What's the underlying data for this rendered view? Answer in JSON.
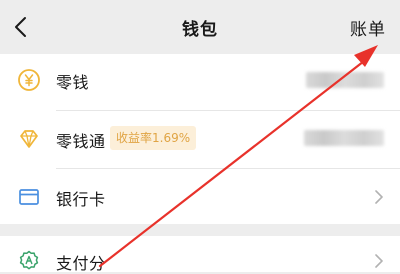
{
  "nav": {
    "back_icon": "chevron-left-icon",
    "title": "钱包",
    "bill_label": "账单"
  },
  "items": [
    {
      "label": "零钱",
      "icon": "yuan-coin-icon",
      "value_hidden": true
    },
    {
      "label": "零钱通",
      "icon": "diamond-icon",
      "badge": "收益率1.69%",
      "value_hidden": true
    },
    {
      "label": "银行卡",
      "icon": "bank-card-icon",
      "chevron": true
    },
    {
      "label": "支付分",
      "icon": "pay-score-icon",
      "chevron": true
    }
  ],
  "colors": {
    "icon_yellow": "#f0b63a",
    "icon_blue": "#4a8fe0",
    "icon_green": "#3aa36b",
    "badge_bg": "#fcefd9",
    "badge_text": "#e0a444",
    "annotation_arrow": "#e8322b"
  }
}
